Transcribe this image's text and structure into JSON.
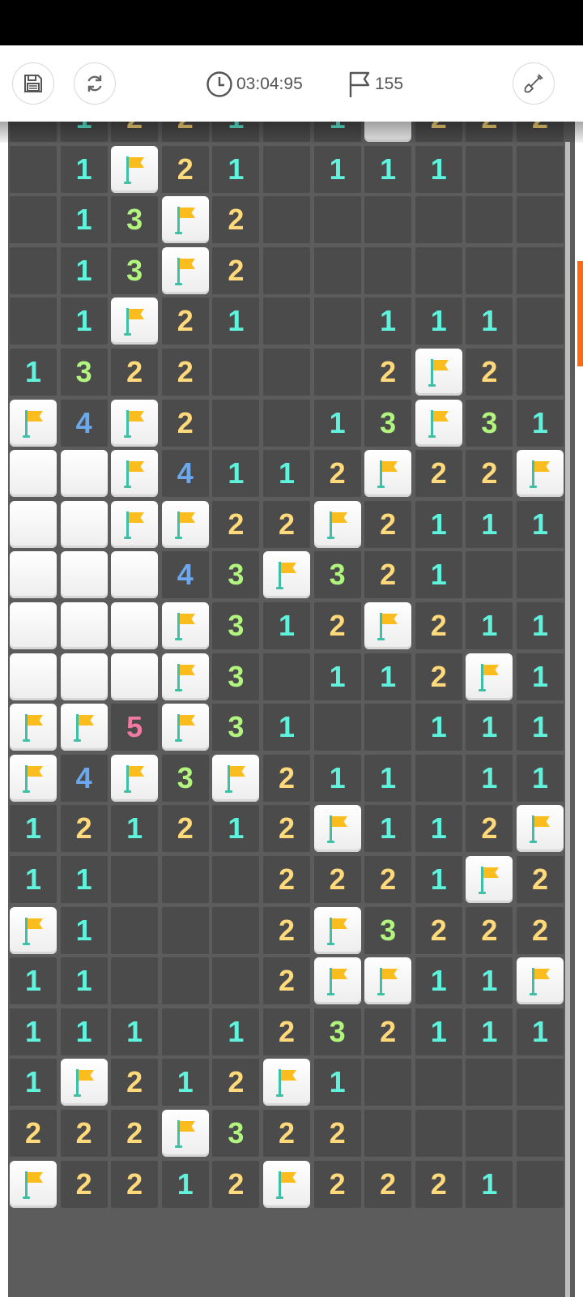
{
  "timer": "03:04:95",
  "flags_remaining": "155",
  "colors": {
    "one": "#5ff2dc",
    "two": "#ffd97a",
    "three": "#b2f57e",
    "four": "#6ba8ee",
    "five": "#f07aa2",
    "accent": "#ff6a13"
  },
  "icons": {
    "save": "floppy-disk-icon",
    "restart": "refresh-icon",
    "timer": "clock-icon",
    "flags": "flag-outline-icon",
    "tool": "shovel-icon"
  },
  "legend": {
    "O": "revealed empty",
    "H": "unrevealed",
    "F": "flag",
    "1-5": "adjacent mine count"
  },
  "board": {
    "rows": [
      [
        "O",
        "1",
        "2",
        "2",
        "1",
        "O",
        "1",
        "H",
        "2",
        "2",
        "2"
      ],
      [
        "O",
        "1",
        "F",
        "2",
        "1",
        "O",
        "1",
        "1",
        "1",
        "O",
        "O"
      ],
      [
        "O",
        "1",
        "3",
        "F",
        "2",
        "O",
        "O",
        "O",
        "O",
        "O",
        "O"
      ],
      [
        "O",
        "1",
        "3",
        "F",
        "2",
        "O",
        "O",
        "O",
        "O",
        "O",
        "O"
      ],
      [
        "O",
        "1",
        "F",
        "2",
        "1",
        "O",
        "O",
        "1",
        "1",
        "1",
        "O"
      ],
      [
        "1",
        "3",
        "2",
        "2",
        "O",
        "O",
        "O",
        "2",
        "F",
        "2",
        "O"
      ],
      [
        "F",
        "4",
        "F",
        "2",
        "O",
        "O",
        "1",
        "3",
        "F",
        "3",
        "1"
      ],
      [
        "H",
        "H",
        "F",
        "4",
        "1",
        "1",
        "2",
        "F",
        "2",
        "2",
        "F"
      ],
      [
        "H",
        "H",
        "F",
        "F",
        "2",
        "2",
        "F",
        "2",
        "1",
        "1",
        "1"
      ],
      [
        "H",
        "H",
        "H",
        "4",
        "3",
        "F",
        "3",
        "2",
        "1",
        "O",
        "O"
      ],
      [
        "H",
        "H",
        "H",
        "F",
        "3",
        "1",
        "2",
        "F",
        "2",
        "1",
        "1"
      ],
      [
        "H",
        "H",
        "H",
        "F",
        "3",
        "O",
        "1",
        "1",
        "2",
        "F",
        "1"
      ],
      [
        "F",
        "F",
        "5",
        "F",
        "3",
        "1",
        "O",
        "O",
        "1",
        "1",
        "1"
      ],
      [
        "F",
        "4",
        "F",
        "3",
        "F",
        "2",
        "1",
        "1",
        "O",
        "1",
        "1"
      ],
      [
        "1",
        "2",
        "1",
        "2",
        "1",
        "2",
        "F",
        "1",
        "1",
        "2",
        "F"
      ],
      [
        "1",
        "1",
        "O",
        "O",
        "O",
        "2",
        "2",
        "2",
        "1",
        "F",
        "2"
      ],
      [
        "F",
        "1",
        "O",
        "O",
        "O",
        "2",
        "F",
        "3",
        "2",
        "2",
        "2"
      ],
      [
        "1",
        "1",
        "O",
        "O",
        "O",
        "2",
        "F",
        "F",
        "1",
        "1",
        "F"
      ],
      [
        "1",
        "1",
        "1",
        "O",
        "1",
        "2",
        "3",
        "2",
        "1",
        "1",
        "1"
      ],
      [
        "1",
        "F",
        "2",
        "1",
        "2",
        "F",
        "1",
        "O",
        "O",
        "O",
        "O"
      ],
      [
        "2",
        "2",
        "2",
        "F",
        "3",
        "2",
        "2",
        "O",
        "O",
        "O",
        "O"
      ],
      [
        "F",
        "2",
        "2",
        "1",
        "2",
        "F",
        "2",
        "2",
        "2",
        "1",
        "O"
      ]
    ]
  }
}
